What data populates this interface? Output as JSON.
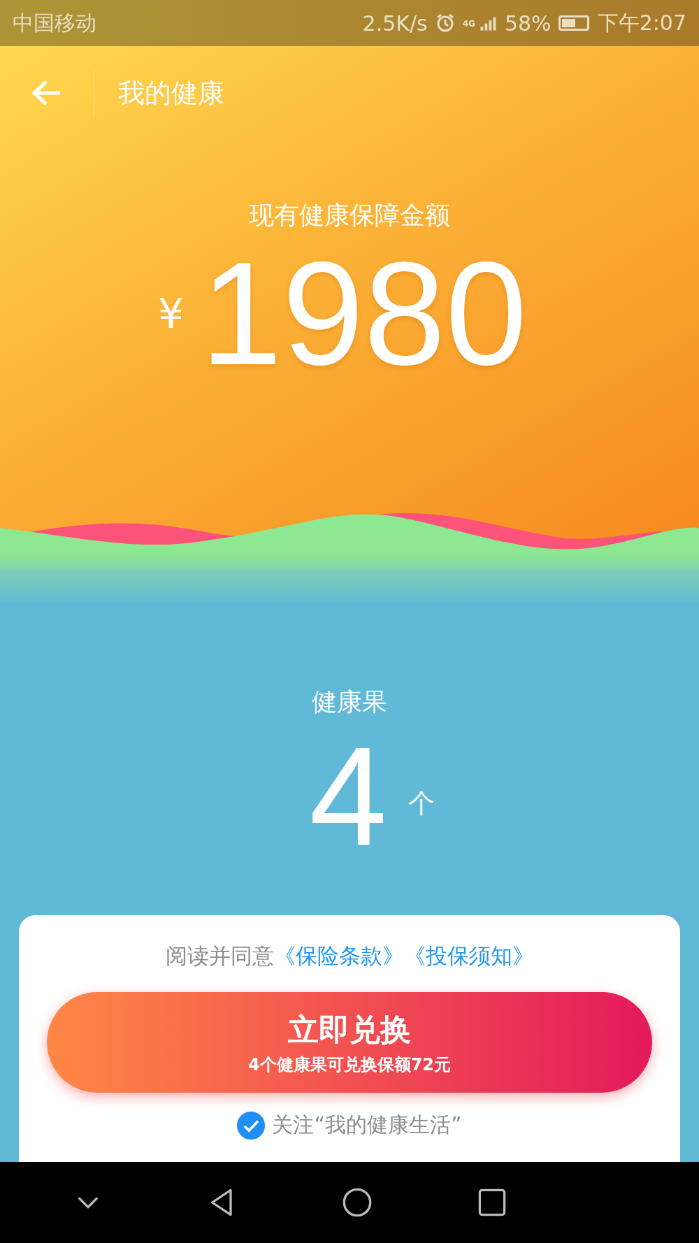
{
  "status_bar": {
    "carrier": "中国移动",
    "net_speed": "2.5K/s",
    "network_type": "4G",
    "battery": "58%",
    "time": "下午2:07"
  },
  "header": {
    "title": "我的健康"
  },
  "balance": {
    "label": "现有健康保障金额",
    "currency": "¥",
    "amount": "1980"
  },
  "fruit": {
    "label": "健康果",
    "count": "4",
    "unit": "个"
  },
  "agreement": {
    "prefix": "阅读并同意",
    "links": [
      "《保险条款》",
      "《投保须知》"
    ]
  },
  "exchange_button": {
    "title": "立即兑换",
    "subtitle": "4个健康果可兑换保额72元"
  },
  "follow": {
    "label": "关注“我的健康生活”",
    "checked": true
  }
}
